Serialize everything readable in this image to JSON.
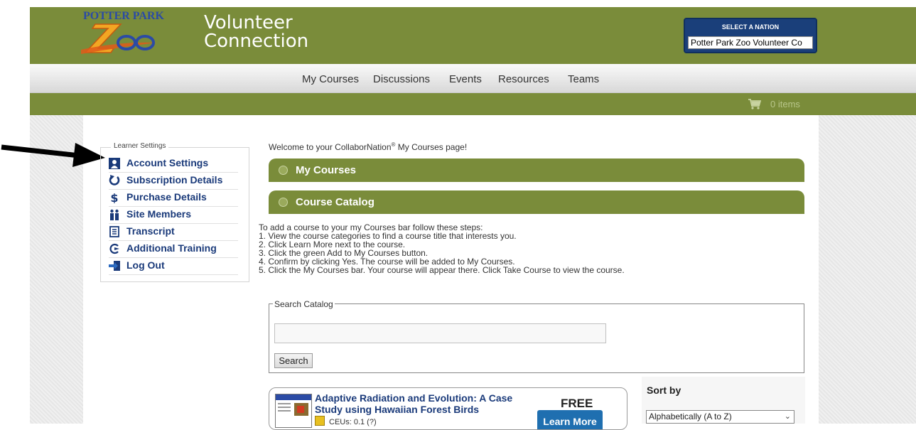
{
  "header": {
    "logo_top": "POTTER PARK",
    "logo_bottom": "Zoo",
    "title_line1": "Volunteer",
    "title_line2": "Connection",
    "nation_label": "SELECT A NATION",
    "nation_value": "Potter Park Zoo Volunteer Co",
    "brand_color": "#7a8c3a"
  },
  "nav": {
    "items": [
      "My Courses",
      "Discussions",
      "Events",
      "Resources",
      "Teams"
    ]
  },
  "cart": {
    "label": "0 items",
    "icon": "cart-icon"
  },
  "settings": {
    "legend": "Learner Settings",
    "items": [
      {
        "label": "Account Settings",
        "icon": "user-icon"
      },
      {
        "label": "Subscription Details",
        "icon": "refresh-icon"
      },
      {
        "label": "Purchase Details",
        "icon": "dollar-icon"
      },
      {
        "label": "Site Members",
        "icon": "members-icon"
      },
      {
        "label": "Transcript",
        "icon": "document-icon"
      },
      {
        "label": "Additional Training",
        "icon": "training-icon"
      },
      {
        "label": "Log Out",
        "icon": "logout-icon"
      }
    ]
  },
  "main": {
    "welcome_pre": "Welcome to your CollaborNation",
    "welcome_reg": "®",
    "welcome_post": " My Courses page!",
    "bar_my_courses": "My Courses",
    "bar_catalog": "Course Catalog",
    "instructions": [
      "To add a course to your my Courses bar follow these steps:",
      "1. View the course categories to find a course title that interests you.",
      "2. Click Learn More next to the course.",
      "3. Click the green Add to My Courses button.",
      "4. Confirm by clicking Yes. The course will be added to My Courses.",
      "5. Click the My Courses bar. Your course will appear there. Click Take Course to view the course."
    ],
    "search_legend": "Search Catalog",
    "search_placeholder": "",
    "search_button": "Search"
  },
  "course": {
    "title": "Adaptive Radiation and Evolution: A Case Study using Hawaiian Forest Birds",
    "ceu": "CEUs: 0.1 (?)",
    "price": "FREE",
    "learn_more": "Learn More"
  },
  "sort": {
    "label": "Sort by",
    "selected": "Alphabetically (A to Z)"
  }
}
